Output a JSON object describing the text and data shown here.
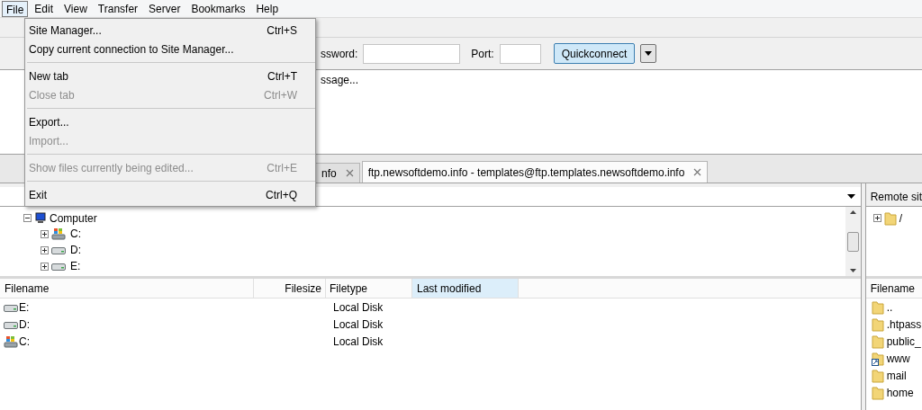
{
  "menubar": [
    {
      "label": "File",
      "selected": true
    },
    {
      "label": "Edit",
      "selected": false
    },
    {
      "label": "View",
      "selected": false
    },
    {
      "label": "Transfer",
      "selected": false
    },
    {
      "label": "Server",
      "selected": false
    },
    {
      "label": "Bookmarks",
      "selected": false
    },
    {
      "label": "Help",
      "selected": false
    }
  ],
  "file_menu": [
    {
      "label": "Site Manager...",
      "shortcut": "Ctrl+S",
      "disabled": false,
      "separator_after": false
    },
    {
      "label": "Copy current connection to Site Manager...",
      "disabled": false,
      "separator_after": true
    },
    {
      "label": "New tab",
      "shortcut": "Ctrl+T",
      "disabled": false,
      "separator_after": false
    },
    {
      "label": "Close tab",
      "shortcut": "Ctrl+W",
      "disabled": true,
      "separator_after": true
    },
    {
      "label": "Export...",
      "disabled": false,
      "separator_after": false
    },
    {
      "label": "Import...",
      "disabled": true,
      "separator_after": true
    },
    {
      "label": "Show files currently being edited...",
      "shortcut": "Ctrl+E",
      "disabled": true,
      "separator_after": true
    },
    {
      "label": "Exit",
      "shortcut": "Ctrl+Q",
      "disabled": false,
      "separator_after": false
    }
  ],
  "quickconnect": {
    "password_label": "ssword:",
    "port_label": "Port:",
    "button": "Quickconnect"
  },
  "message_log": "ssage...",
  "tabs": [
    {
      "label": "nfo",
      "selected": false
    },
    {
      "label": "ftp.newsoftdemo.info - templates@ftp.templates.newsoftdemo.info",
      "selected": true
    }
  ],
  "local_tree": [
    {
      "label": "Computer",
      "expanded": true,
      "children": [
        {
          "label": "C:",
          "kind": "system"
        },
        {
          "label": "D:",
          "kind": "drive"
        },
        {
          "label": "E:",
          "kind": "drive"
        }
      ]
    }
  ],
  "remote_site": {
    "label": "Remote sit",
    "tree": [
      {
        "label": "/"
      }
    ]
  },
  "local_table": {
    "columns": [
      {
        "label": "Filename",
        "sorted": false
      },
      {
        "label": "Filesize",
        "sorted": false
      },
      {
        "label": "Filetype",
        "sorted": false
      },
      {
        "label": "Last modified",
        "sorted": true
      }
    ],
    "rows": [
      {
        "name": "E:",
        "kind": "drive",
        "type": "Local Disk"
      },
      {
        "name": "D:",
        "kind": "drive",
        "type": "Local Disk"
      },
      {
        "name": "C:",
        "kind": "system",
        "type": "Local Disk"
      }
    ]
  },
  "remote_table": {
    "columns": [
      "Filename"
    ],
    "rows": [
      {
        "name": "..",
        "kind": "folder"
      },
      {
        "name": ".htpass",
        "kind": "folder"
      },
      {
        "name": "public_",
        "kind": "folder"
      },
      {
        "name": "www",
        "kind": "link"
      },
      {
        "name": "mail",
        "kind": "folder"
      },
      {
        "name": "home",
        "kind": "folder"
      }
    ]
  }
}
